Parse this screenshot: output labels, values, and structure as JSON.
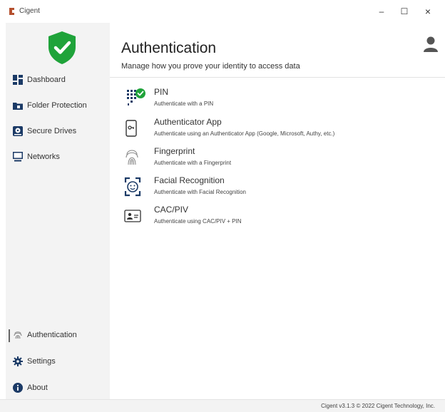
{
  "window": {
    "title": "Cigent",
    "minimize_symbol": "–",
    "maximize_symbol": "☐",
    "close_symbol": "×"
  },
  "sidebar": {
    "items": [
      {
        "label": "Dashboard",
        "icon": "dashboard-icon"
      },
      {
        "label": "Folder Protection",
        "icon": "folder-icon"
      },
      {
        "label": "Secure Drives",
        "icon": "drive-icon"
      },
      {
        "label": "Networks",
        "icon": "monitor-icon"
      }
    ],
    "bottom_items": [
      {
        "label": "Authentication",
        "icon": "fingerprint-icon",
        "active": true
      },
      {
        "label": "Settings",
        "icon": "gear-icon"
      },
      {
        "label": "About",
        "icon": "info-icon"
      }
    ]
  },
  "main": {
    "title": "Authentication",
    "subtitle": "Manage how you prove your identity to access data",
    "methods": [
      {
        "name": "PIN",
        "description": "Authenticate with a PIN",
        "icon": "keypad-check-icon",
        "enabled": true
      },
      {
        "name": "Authenticator App",
        "description": "Authenticate using an Authenticator App (Google, Microsoft, Authy, etc.)",
        "icon": "phone-key-icon"
      },
      {
        "name": "Fingerprint",
        "description": "Authenticate with a Fingerprint",
        "icon": "fingerprint-icon"
      },
      {
        "name": "Facial Recognition",
        "description": "Authenticate with Facial Recognition",
        "icon": "face-scan-icon"
      },
      {
        "name": "CAC/PIV",
        "description": "Authenticate using CAC/PIV + PIN",
        "icon": "id-card-icon"
      }
    ]
  },
  "footer": {
    "text": "Cigent v3.1.3 © 2022 Cigent Technology, Inc."
  },
  "colors": {
    "accent_green": "#1fa33a",
    "icon_navy": "#1b3a66",
    "sidebar_bg": "#f3f3f3"
  }
}
